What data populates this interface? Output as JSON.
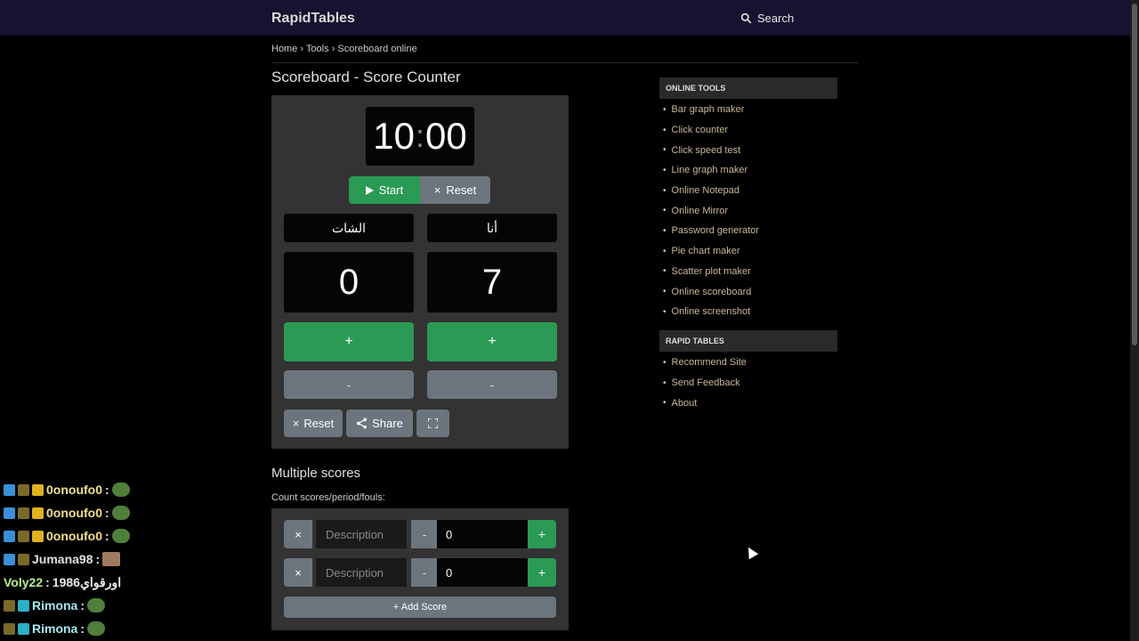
{
  "header": {
    "brand": "RapidTables",
    "search_label": "Search"
  },
  "breadcrumb": {
    "home": "Home",
    "sep1": "›",
    "tools": "Tools",
    "sep2": "›",
    "current": "Scoreboard online"
  },
  "page_title": "Scoreboard - Score Counter",
  "timer": {
    "minutes": "10",
    "separator": ":",
    "seconds": "00"
  },
  "timer_controls": {
    "start": "Start",
    "reset": "Reset"
  },
  "teams": [
    {
      "name": "الشات",
      "score": "0",
      "plus": "+",
      "minus": "-"
    },
    {
      "name": "أنا",
      "score": "7",
      "plus": "+",
      "minus": "-"
    }
  ],
  "bottom_controls": {
    "reset": "Reset",
    "share": "Share"
  },
  "multiple": {
    "title": "Multiple scores",
    "subtitle": "Count scores/period/fouls:",
    "rows": [
      {
        "remove": "×",
        "placeholder": "Description",
        "minus": "-",
        "value": "0",
        "plus": "+"
      },
      {
        "remove": "×",
        "placeholder": "Description",
        "minus": "-",
        "value": "0",
        "plus": "+"
      }
    ],
    "add_label": "+ Add Score"
  },
  "sidebar": {
    "online_tools_heading": "ONLINE TOOLS",
    "online_tools": [
      "Bar graph maker",
      "Click counter",
      "Click speed test",
      "Line graph maker",
      "Online Notepad",
      "Online Mirror",
      "Password generator",
      "Pie chart maker",
      "Scatter plot maker",
      "Online scoreboard",
      "Online screenshot"
    ],
    "rapid_tables_heading": "RAPID TABLES",
    "rapid_tables": [
      "Recommend Site",
      "Send Feedback",
      "About"
    ]
  },
  "chat": [
    {
      "user": "0onoufo0",
      "sep": ":",
      "color": "#f0e08a"
    },
    {
      "user": "0onoufo0",
      "sep": ":",
      "color": "#f0e08a"
    },
    {
      "user": "0onoufo0",
      "sep": ":",
      "color": "#f0e08a"
    },
    {
      "user": "Jumana98",
      "sep": ":",
      "color": "#e0e0e0"
    },
    {
      "user": "Voly22",
      "sep": ":",
      "message": "اورقواي1986",
      "color": "#b8f08a"
    },
    {
      "user": "Rimona",
      "sep": ":",
      "color": "#a8e8f0"
    },
    {
      "user": "Rimona",
      "sep": ":",
      "color": "#a8e8f0"
    }
  ],
  "colors": {
    "green": "#2a9a55",
    "gray": "#6c757d",
    "topbar": "#16122f",
    "link": "#c8b89a"
  }
}
